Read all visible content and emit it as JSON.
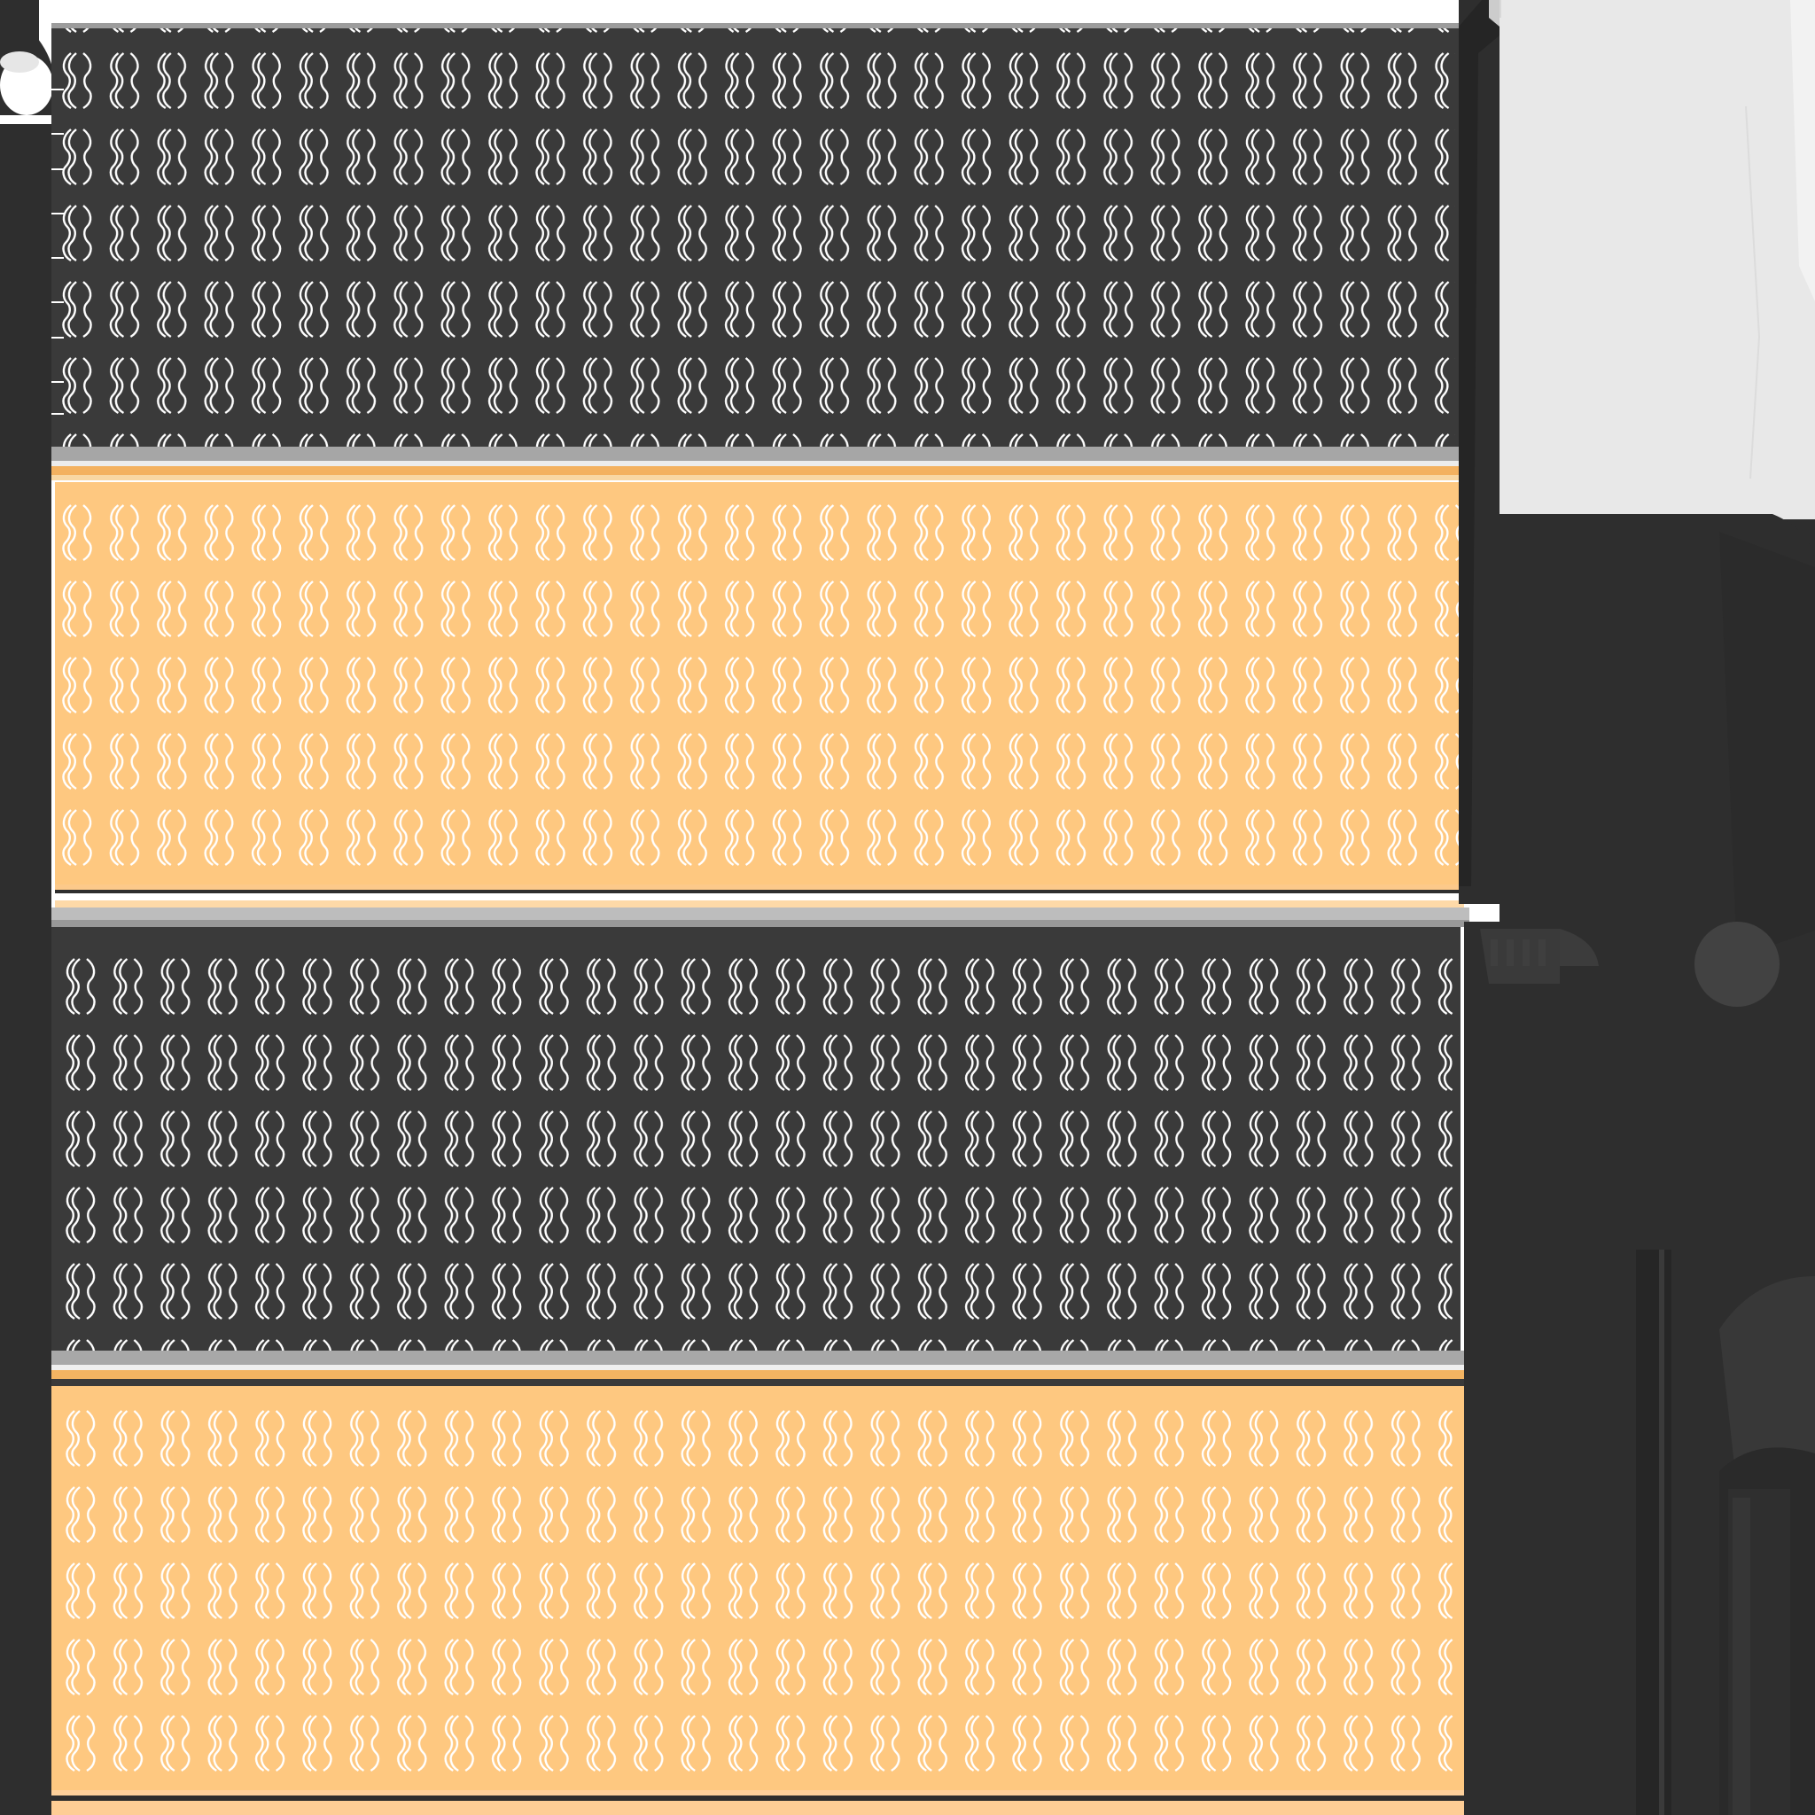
{
  "texture_sheet": {
    "colors": {
      "dark_fabric": "#3a3a3a",
      "tan_fabric": "#fec880",
      "frame": "#2e2e2e",
      "light_panel": "#e8e8e8",
      "grey_trim": "#a8a8a8",
      "pattern_line": "#ffffff",
      "knob": "#3f3f3f"
    },
    "bands": [
      {
        "name": "dark-band-1",
        "tone": "dark",
        "rows": 5
      },
      {
        "name": "tan-band-1",
        "tone": "tan",
        "rows": 5
      },
      {
        "name": "dark-band-2",
        "tone": "dark",
        "rows": 5
      },
      {
        "name": "tan-band-2",
        "tone": "tan",
        "rows": 5
      }
    ],
    "pattern_motif": "double-chain-link-icon",
    "pattern_columns": 30
  }
}
